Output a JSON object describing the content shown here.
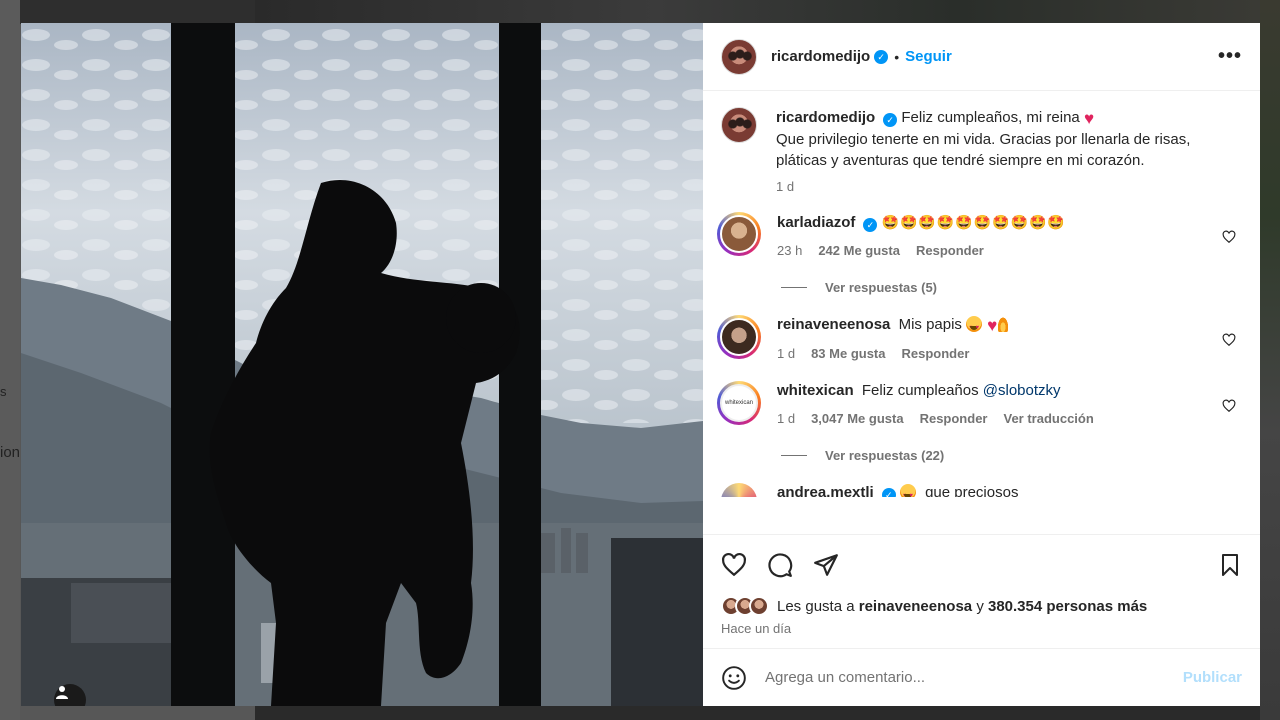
{
  "background": {
    "left_edge_text": "ion",
    "left_edge_dot": "s"
  },
  "post": {
    "author": "ricardomedijo",
    "follow_label": "Seguir",
    "separator": "•",
    "more_label": "•••",
    "caption_line1": "Feliz cumpleaños, mi reina",
    "caption_rest": "Que privilegio tenerte en mi vida. Gracias por llenarla de risas, pláticas y aventuras que tendré siempre en mi corazón.",
    "caption_time": "1 d",
    "comments": [
      {
        "user": "karladiazof",
        "verified": true,
        "text": "🤩🤩🤩🤩🤩🤩🤩🤩🤩🤩",
        "time": "23 h",
        "likes": "242 Me gusta",
        "reply": "Responder",
        "view_replies": "Ver respuestas (5)"
      },
      {
        "user": "reinaveneenosa",
        "verified": false,
        "text": "Mis papis",
        "time": "1 d",
        "likes": "83 Me gusta",
        "reply": "Responder"
      },
      {
        "user": "whitexican",
        "verified": false,
        "text": "Feliz cumpleaños",
        "mention": "@slobotzky",
        "time": "1 d",
        "likes": "3,047 Me gusta",
        "reply": "Responder",
        "translate": "Ver traducción",
        "view_replies": "Ver respuestas (22)"
      },
      {
        "user": "andrea.mextli",
        "verified": true,
        "text": "que preciosos"
      }
    ],
    "likes_prefix": "Les gusta a",
    "likes_user": "reinaveneenosa",
    "likes_connector": "y",
    "likes_count": "380.354 personas más",
    "posted_ago": "Hace un día",
    "comment_placeholder": "Agrega un comentario...",
    "publish_label": "Publicar",
    "avatar_thumb_text": "whitexican"
  },
  "colors": {
    "accent": "#0095f6",
    "publish_disabled": "#b2dffc",
    "heart": "#ed1c3a"
  },
  "icons": [
    "heart-icon",
    "comment-icon",
    "share-icon",
    "bookmark-icon",
    "emoji-icon",
    "user-tag-icon",
    "verified-icon"
  ]
}
